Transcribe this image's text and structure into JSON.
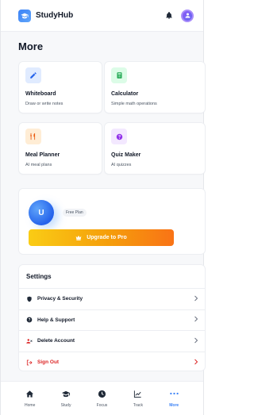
{
  "header": {
    "app_title": "StudyHub",
    "logo_icon": "graduation-cap-icon",
    "bell_icon": "bell-icon"
  },
  "page": {
    "title": "More"
  },
  "tools": [
    {
      "title": "Whiteboard",
      "subtitle": "Draw or write notes",
      "icon": "pen-icon",
      "bg": "#e0ebff",
      "fg": "#2563eb"
    },
    {
      "title": "Calculator",
      "subtitle": "Simple math operations",
      "icon": "calculator-icon",
      "bg": "#dcfce7",
      "fg": "#16a34a"
    },
    {
      "title": "Meal Planner",
      "subtitle": "AI meal plans",
      "icon": "utensils-icon",
      "bg": "#ffedd5",
      "fg": "#ea580c"
    },
    {
      "title": "Quiz Maker",
      "subtitle": "AI quizzes",
      "icon": "question-icon",
      "bg": "#f3e8ff",
      "fg": "#9333ea"
    }
  ],
  "plan": {
    "avatar_initial": "U",
    "badge": "Free Plan",
    "upgrade_label": "Upgrade to Pro"
  },
  "settings": {
    "title": "Settings",
    "items": [
      {
        "label": "Privacy & Security",
        "icon": "shield-icon"
      },
      {
        "label": "Help & Support",
        "icon": "help-icon"
      },
      {
        "label": "Delete Account",
        "icon": "delete-user-icon"
      },
      {
        "label": "Sign Out",
        "icon": "sign-out-icon"
      }
    ]
  },
  "nav": [
    {
      "label": "Home",
      "icon": "home-icon"
    },
    {
      "label": "Study",
      "icon": "graduation-cap-icon"
    },
    {
      "label": "Focus",
      "icon": "clock-icon"
    },
    {
      "label": "Track",
      "icon": "chart-line-icon"
    },
    {
      "label": "More",
      "icon": "more-dots-icon",
      "active": true
    }
  ],
  "colors": {
    "accent": "#3b82f6",
    "danger": "#dc2626"
  }
}
